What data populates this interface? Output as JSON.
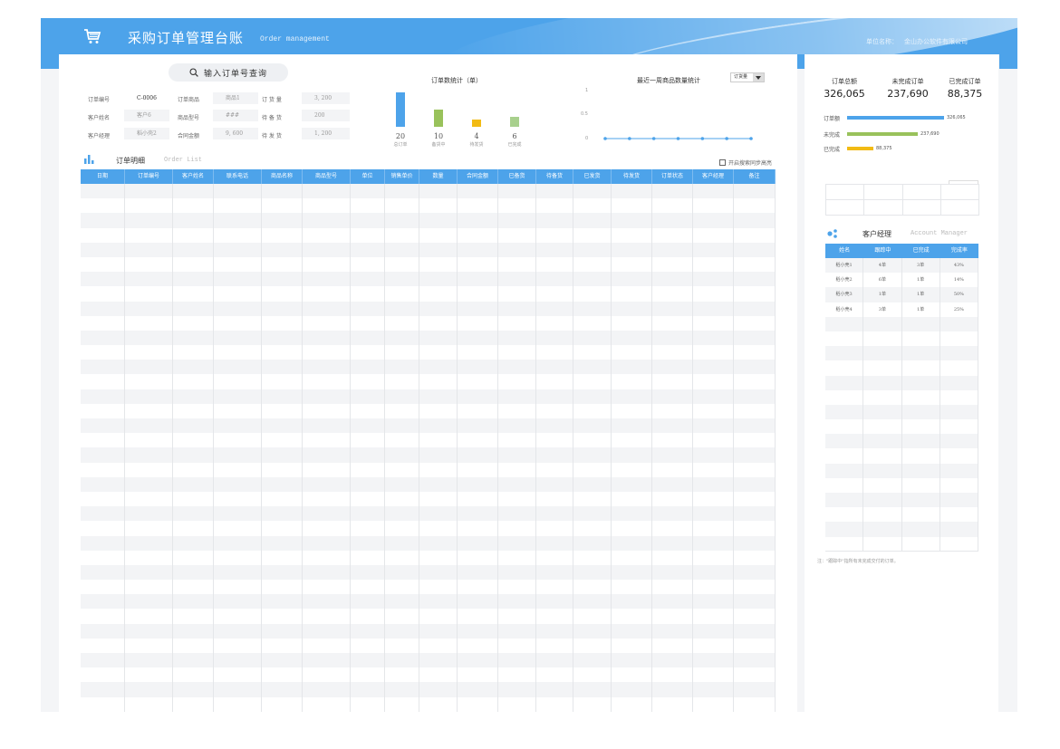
{
  "header": {
    "title": "采购订单管理台账",
    "subtitle": "Order management",
    "company_label": "单位名称：",
    "company_name": "金山办公软件有限公司"
  },
  "search": {
    "placeholder": "输入订单号查询"
  },
  "form": {
    "order_no_label": "订单编号",
    "order_no": "C-0006",
    "product_label": "订单商品",
    "product": "商品1",
    "order_qty_label": "订 货 量",
    "order_qty": "3, 200",
    "customer_label": "客户姓名",
    "customer": "客户6",
    "model_label": "商品型号",
    "model": "###",
    "prepared_label": "待 备 货",
    "prepared": "200",
    "manager_label": "客户经理",
    "manager": "稻小壳2",
    "amount_label": "合同金额",
    "amount": "9, 600",
    "shipped_label": "待 发 货",
    "shipped": "1, 200"
  },
  "order_stats": {
    "title": "订单数统计（单）",
    "colors": [
      "#4da3ea",
      "#99c25b",
      "#f2bb14",
      "#a8d08d"
    ],
    "items": [
      {
        "value": "20",
        "label": "总订单",
        "num": 20
      },
      {
        "value": "10",
        "label": "备货中",
        "num": 10
      },
      {
        "value": "4",
        "label": "待发货",
        "num": 4
      },
      {
        "value": "6",
        "label": "已完成",
        "num": 6
      }
    ]
  },
  "chart_data": {
    "type": "line",
    "title": "最近一周商品数量统计",
    "y_ticks": [
      "1",
      "0.5",
      "0"
    ],
    "ylim": [
      0,
      1
    ],
    "series": [
      {
        "values": [
          0,
          0,
          0,
          0,
          0,
          0,
          0
        ]
      }
    ],
    "color": "#4da3ea"
  },
  "filter": {
    "selected": "订货量"
  },
  "order_list": {
    "title": "订单明细",
    "subtitle": "Order List",
    "highlight_label": "开启搜索同步高亮",
    "columns": [
      "日期",
      "订单编号",
      "客户姓名",
      "联系电话",
      "商品名称",
      "商品型号",
      "单位",
      "销售单价",
      "数量",
      "合同金额",
      "已备货",
      "待备货",
      "已发货",
      "待发货",
      "订单状态",
      "客户经理",
      "备注"
    ]
  },
  "summary": {
    "items": [
      {
        "label": "订单总额",
        "value": "326,065"
      },
      {
        "label": "未完成订单",
        "value": "237,690"
      },
      {
        "label": "已完成订单",
        "value": "88,375"
      }
    ],
    "bars": [
      {
        "label": "订单额",
        "value": "326,065",
        "num": 326065,
        "color": "#4da3ea"
      },
      {
        "label": "未完成",
        "value": "237,690",
        "num": 237690,
        "color": "#99c25b"
      },
      {
        "label": "已完成",
        "value": "88,375",
        "num": 88375,
        "color": "#f2bb14"
      }
    ]
  },
  "account_manager": {
    "title": "客户经理",
    "subtitle": "Account Manager",
    "columns": [
      "姓名",
      "跟踪中",
      "已完成",
      "完成率"
    ],
    "rows": [
      [
        "稻小壳1",
        "4单",
        "3单",
        "43%"
      ],
      [
        "稻小壳2",
        "6单",
        "1单",
        "14%"
      ],
      [
        "稻小壳3",
        "1单",
        "1单",
        "50%"
      ],
      [
        "稻小壳4",
        "3单",
        "1单",
        "25%"
      ]
    ]
  },
  "note": "注：\"跟踪中\"指所有未完成交付的订单。"
}
